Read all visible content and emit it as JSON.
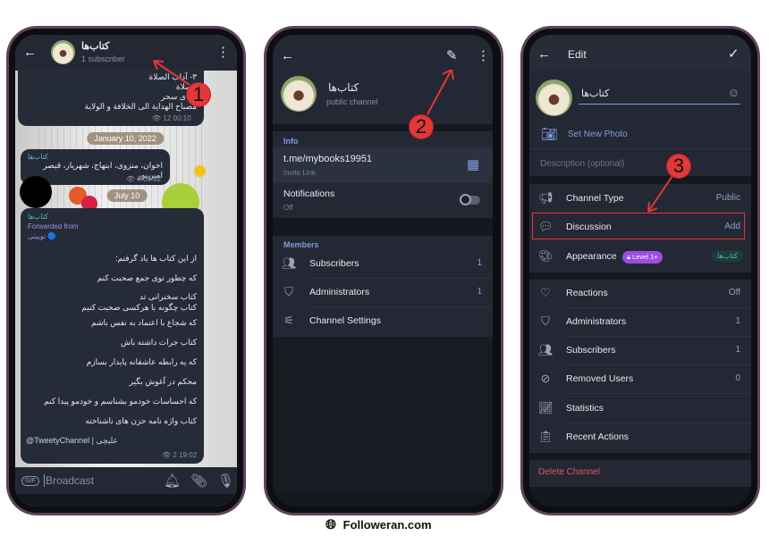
{
  "phone1": {
    "channel_name": "کتاب‌ها",
    "subtitle": "1 subscriber",
    "msg1": {
      "lines": [
        "۳- آداب الصلاة",
        "الصلاة",
        "دعای سحر",
        "مصباح الهدایة الی الخلافة و الولایة"
      ],
      "views": "12",
      "time": "00:10"
    },
    "date1": "January 10, 2022",
    "msg2": {
      "author": "کتاب‌ها",
      "text": "اخوان، منزوی، ابتهاج، شهریار، قیصر امین‌پور",
      "views": "6",
      "time": "02:02"
    },
    "date2": "July 10",
    "msg3": {
      "author": "کتاب‌ها",
      "forwarded": "Forwarded from",
      "source": "توییتی",
      "lines": [
        "از این کتاب ها یاد گرفتم:",
        "که چطور توی جمع صحبت کنم",
        "کتاب سخنرانی تد",
        "کتاب چگونه با هرکسی صحبت کنیم",
        "که شجاع با اعتماد به نفس باشم",
        "کتاب جرات داشته باش",
        "که یه رابطه عاشقانه پایدار بسازم",
        "محکم در آغوش بگیر",
        "که احساسات خودمو بشناسم و خودمو پیدا کنم",
        "کتاب واژه نامه حزن های ناشناخته"
      ],
      "signature": "@TweetyChannel | علیچی",
      "views": "2",
      "time": "19:02"
    },
    "input_placeholder": "Broadcast",
    "gif_label": "GIF"
  },
  "phone2": {
    "channel_name": "کتاب‌ها",
    "subtitle": "public channel",
    "info_header": "Info",
    "link": "t.me/mybooks19951",
    "link_caption": "Invite Link",
    "notifications": "Notifications",
    "notifications_state": "Off",
    "members_header": "Members",
    "rows": [
      {
        "label": "Subscribers",
        "value": "1",
        "icon": "users-icon"
      },
      {
        "label": "Administrators",
        "value": "1",
        "icon": "shield-icon"
      },
      {
        "label": "Channel Settings",
        "value": "",
        "icon": "sliders-icon"
      }
    ]
  },
  "phone3": {
    "title": "Edit",
    "channel_name": "کتاب‌ها",
    "set_photo": "Set New Photo",
    "description_placeholder": "Description (optional)",
    "group1": [
      {
        "label": "Channel Type",
        "value": "Public",
        "icon": "megaphone-icon"
      },
      {
        "label": "Discussion",
        "value": "Add",
        "icon": "chat-icon"
      },
      {
        "label": "Appearance",
        "value": "کتاب‌ها",
        "icon": "palette-icon",
        "badge": "Level 1+"
      }
    ],
    "group2": [
      {
        "label": "Reactions",
        "value": "Off",
        "icon": "heart-icon"
      },
      {
        "label": "Administrators",
        "value": "1",
        "icon": "shield-icon"
      },
      {
        "label": "Subscribers",
        "value": "1",
        "icon": "users-icon"
      },
      {
        "label": "Removed Users",
        "value": "0",
        "icon": "user-blocked-icon"
      },
      {
        "label": "Statistics",
        "value": "",
        "icon": "chart-icon"
      },
      {
        "label": "Recent Actions",
        "value": "",
        "icon": "clipboard-icon"
      }
    ],
    "delete": "Delete Channel"
  },
  "steps": [
    "1",
    "2",
    "3"
  ],
  "footer": "Followeran.com",
  "colors": {
    "accent": "#7d9fdc",
    "annotation": "#e23838",
    "danger": "#e0555f",
    "background": "#1c2029"
  }
}
